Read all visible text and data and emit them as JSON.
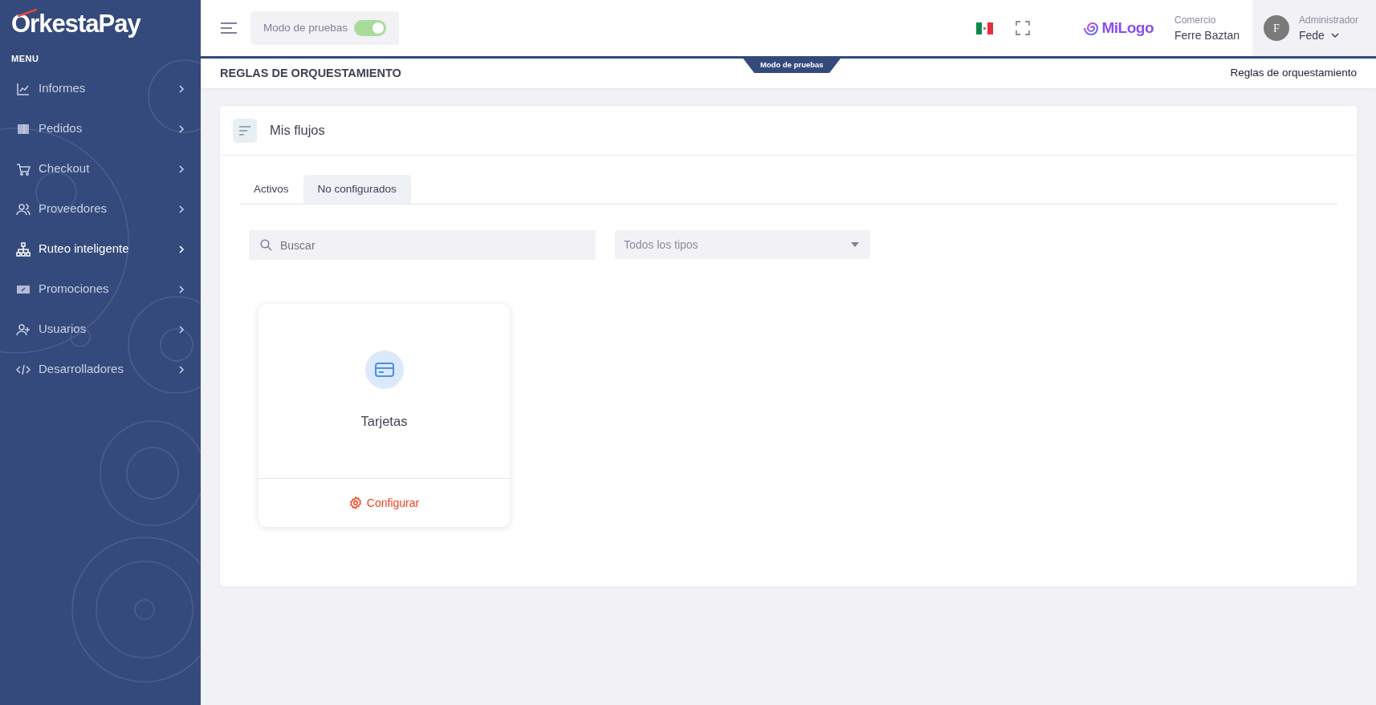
{
  "sidebar": {
    "logo": "OrkestaPay",
    "menu_heading": "MENU",
    "items": [
      {
        "label": "Informes",
        "selected": false
      },
      {
        "label": "Pedidos",
        "selected": false
      },
      {
        "label": "Checkout",
        "selected": false
      },
      {
        "label": "Proveedores",
        "selected": false
      },
      {
        "label": "Ruteo inteligente",
        "selected": true
      },
      {
        "label": "Promociones",
        "selected": false
      },
      {
        "label": "Usuarios",
        "selected": false
      },
      {
        "label": "Desarrolladores",
        "selected": false
      }
    ]
  },
  "header": {
    "test_mode": {
      "label": "Modo de pruebas",
      "on": true
    },
    "merchant_logo": "MiLogo",
    "merchant": {
      "label": "Comercio",
      "name": "Ferre Baztan"
    },
    "user": {
      "initial": "F",
      "role": "Administrador",
      "name": "Fede"
    }
  },
  "ribbon": "Modo de pruebas",
  "page": {
    "title": "REGLAS DE ORQUESTAMIENTO",
    "breadcrumb": "Reglas de orquestamiento"
  },
  "panel": {
    "title": "Mis flujos",
    "tabs": [
      {
        "label": "Activos",
        "selected": false
      },
      {
        "label": "No configurados",
        "selected": true
      }
    ],
    "search": {
      "placeholder": "Buscar"
    },
    "type_filter": {
      "placeholder": "Todos los tipos"
    },
    "flows": [
      {
        "name": "Tarjetas",
        "action": "Configurar"
      }
    ]
  }
}
